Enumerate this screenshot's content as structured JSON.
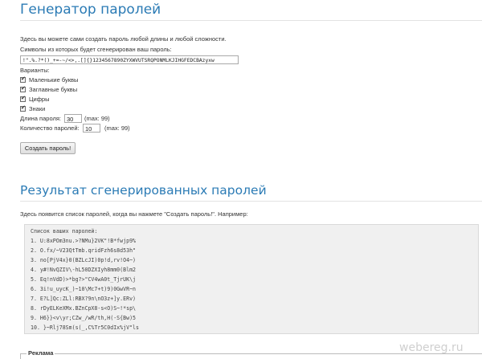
{
  "generator": {
    "title": "Генератор паролей",
    "intro": "Здесь вы можете сами создать пароль любой длины и любой сложности.",
    "charset_label": "Символы из которых будет сгенерирован ваш пароль:",
    "charset_value": "!\".%.?*()_+=-~/<>,.[]{}1234567890ZYXWVUTSRQPONMLKJIHGFEDCBAzyxw",
    "options_label": "Варианты:",
    "options": [
      {
        "label": "Маленькие буквы",
        "checked": true
      },
      {
        "label": "Заглавные буквы",
        "checked": true
      },
      {
        "label": "Цифры",
        "checked": true
      },
      {
        "label": "Знаки",
        "checked": true
      }
    ],
    "length_label": "Длина пароля:",
    "length_value": "30",
    "length_max": "(max: 99)",
    "count_label": "Количество паролей:",
    "count_value": "10",
    "count_max": "(max: 99)",
    "create_button": "Создать пароль!"
  },
  "result": {
    "title": "Результат сгенерированных паролей",
    "intro": "Здесь появится список паролей, когда вы нажмете \"Создать пароль!\". Например:",
    "list_header": "Список ваших паролей:",
    "passwords": [
      "1.  U:8xPOm3nu.>?NMu}2VK\"!B*fwjp9%",
      "2.  O.fx/~V23QtTmb.qridFzh6s8d53h\"",
      "3.  no[PjV4x}0(BZLcJI)0p!d,rv!O4~)",
      "4.  y#!NvQZIV\\-hL50DZXIyh8mm0(Blm2",
      "5.  Eq!nVdD)>*bg?>\"CV4wA0t_TjrUK\\j",
      "6.  3i!u_uycK_)~10\\Mc7+t)9)0GwVR~n",
      "7.  E?L]Qc:ZLl:RBX?9n\\nO3z+]y.ERv)",
      "8.  rDyELKeXMx.BZnCpX8-s<O)S~!*sp\\",
      "9.  H6}}<v\\yr;CZw_/wR/th,H(-S{Bw)5",
      "10.  }~Rlj78Sm(s(_,C%Tr5C0dIx%jV\"ls"
    ]
  },
  "ad": {
    "label": "Реклама"
  },
  "watermark": "webereg.ru",
  "colors": {
    "heading": "#2b7bb5",
    "result_bg": "#f0f0f0"
  }
}
